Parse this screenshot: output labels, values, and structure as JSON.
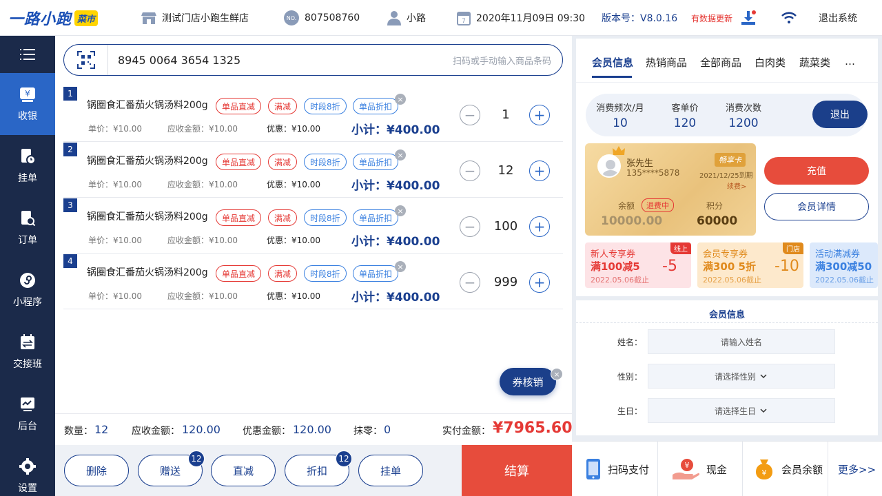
{
  "topbar": {
    "logo_text": "一路小跑",
    "logo_badge": "菜市",
    "store": "测试门店小跑生鲜店",
    "store_no": "807508760",
    "user": "小路",
    "datetime": "2020年11月09日 09:30",
    "version": "版本号：V8.0.16",
    "update_note": "有数据更新",
    "logout": "退出系统",
    "no_badge": "NO.",
    "calendar_day": "7"
  },
  "sidebar": {
    "items": [
      {
        "label": "收银",
        "icon": "yen-icon"
      },
      {
        "label": "挂单",
        "icon": "hold-order-icon"
      },
      {
        "label": "订单",
        "icon": "order-search-icon"
      },
      {
        "label": "小程序",
        "icon": "mini-program-icon"
      },
      {
        "label": "交接班",
        "icon": "shift-handover-icon"
      },
      {
        "label": "后台",
        "icon": "backend-icon"
      },
      {
        "label": "设置",
        "icon": "gear-icon"
      }
    ],
    "yen": "¥"
  },
  "scan": {
    "value": "8945 0064 3654 1325",
    "placeholder": "扫码或手动输入商品条码"
  },
  "items": [
    {
      "no": "1",
      "name": "锅圈食汇番茄火锅汤料200g",
      "tags": [
        "单品直减",
        "满减",
        "时段8折",
        "单品折扣"
      ],
      "unit_price": "单价：¥10.00",
      "receivable": "应收金额：¥10.00",
      "discount": "优惠：¥10.00",
      "subtotal": "小计：¥400.00",
      "qty": "1"
    },
    {
      "no": "2",
      "name": "锅圈食汇番茄火锅汤料200g",
      "tags": [
        "单品直减",
        "满减",
        "时段8折",
        "单品折扣"
      ],
      "unit_price": "单价：¥10.00",
      "receivable": "应收金额：¥10.00",
      "discount": "优惠：¥10.00",
      "subtotal": "小计：¥400.00",
      "qty": "12"
    },
    {
      "no": "3",
      "name": "锅圈食汇番茄火锅汤料200g",
      "tags": [
        "单品直减",
        "满减",
        "时段8折",
        "单品折扣"
      ],
      "unit_price": "单价：¥10.00",
      "receivable": "应收金额：¥10.00",
      "discount": "优惠：¥10.00",
      "subtotal": "小计：¥400.00",
      "qty": "100"
    },
    {
      "no": "4",
      "name": "锅圈食汇番茄火锅汤料200g",
      "tags": [
        "单品直减",
        "满减",
        "时段8折",
        "单品折扣"
      ],
      "unit_price": "单价：¥10.00",
      "receivable": "应收金额：¥10.00",
      "discount": "优惠：¥10.00",
      "subtotal": "小计：¥400.00",
      "qty": "999"
    }
  ],
  "coupon_button": "券核销",
  "summary": {
    "qty_label": "数量：",
    "qty": "12",
    "recv_label": "应收金额：",
    "recv": "120.00",
    "disc_label": "优惠金额：",
    "disc": "120.00",
    "round_label": "抹零：",
    "round": "0",
    "paid_label": "实付金额：",
    "paid": "¥7965.60"
  },
  "actions": [
    {
      "label": "删除"
    },
    {
      "label": "赠送",
      "badge": "12"
    },
    {
      "label": "直减"
    },
    {
      "label": "折扣",
      "badge": "12"
    },
    {
      "label": "挂单"
    }
  ],
  "settle": "结算",
  "tabs": [
    "会员信息",
    "热销商品",
    "全部商品",
    "白肉类",
    "蔬菜类",
    "…"
  ],
  "stats": [
    {
      "label": "消费频次/月",
      "value": "10"
    },
    {
      "label": "客单价",
      "value": "120"
    },
    {
      "label": "消费次数",
      "value": "1200"
    }
  ],
  "exit_label": "退出",
  "member_card": {
    "name": "张先生",
    "phone": "135****5878",
    "brand": "畅享卡",
    "expire": "2021/12/25到期",
    "renew": "续费>",
    "balance_label": "余额",
    "refund": "退费中",
    "balance": "10000.00",
    "points_label": "积分",
    "points": "60000"
  },
  "recharge": "充值",
  "member_detail": "会员详情",
  "coupons": [
    {
      "title": "新人专享券",
      "main": "满100减5",
      "date": "2022.05.06截止",
      "value": "-5",
      "badge": "线上",
      "bg": "#fde3e6",
      "fg": "#e53935"
    },
    {
      "title": "会员专享券",
      "main": "满300 5折",
      "date": "2022.05.06截止",
      "value": "-10",
      "badge": "门店",
      "bg": "#fde9cc",
      "fg": "#e08a1c"
    },
    {
      "title": "活动满减券",
      "main": "满300减50",
      "date": "2022.05.06截止",
      "value": "",
      "badge": "",
      "bg": "#dce9fb",
      "fg": "#3a80e0"
    }
  ],
  "form": {
    "title": "会员信息",
    "name_label": "姓名：",
    "name_ph": "请输入姓名",
    "gender_label": "性别：",
    "gender_ph": "请选择性别",
    "birth_label": "生日：",
    "birth_ph": "请选择生日"
  },
  "payments": [
    "扫码支付",
    "现金",
    "会员余额",
    "更多>>"
  ],
  "pay_icon_text": {
    "cash": "¥",
    "balance": "¥"
  }
}
